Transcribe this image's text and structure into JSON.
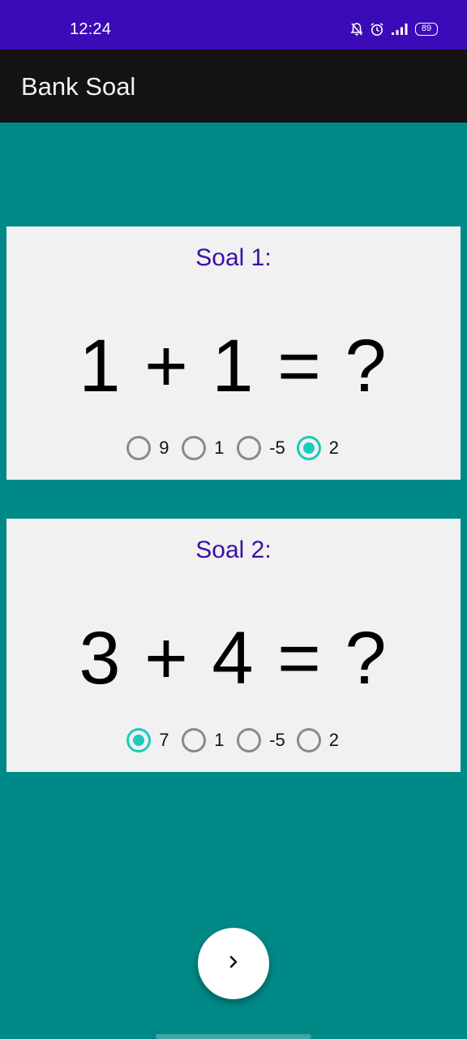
{
  "status_bar": {
    "time": "12:24",
    "battery": "89",
    "icons": [
      "bell-off-icon",
      "alarm-icon",
      "signal-icon",
      "battery-icon"
    ]
  },
  "app_bar": {
    "title": "Bank Soal"
  },
  "questions": [
    {
      "label": "Soal 1:",
      "expression": "1 + 1 = ?",
      "options": [
        "9",
        "1",
        "-5",
        "2"
      ],
      "selected": "2"
    },
    {
      "label": "Soal 2:",
      "expression": "3 + 4 = ?",
      "options": [
        "7",
        "1",
        "-5",
        "2"
      ],
      "selected": "7"
    }
  ],
  "fab": {
    "icon": "chevron-right-icon"
  },
  "colors": {
    "status_bar": "#3b0bb7",
    "app_bar": "#131313",
    "background": "#008a87",
    "card": "#f1f1f1",
    "question_label": "#3a0fa6",
    "radio_checked": "#1ccbbc",
    "radio_unchecked": "#8a8a8a"
  }
}
